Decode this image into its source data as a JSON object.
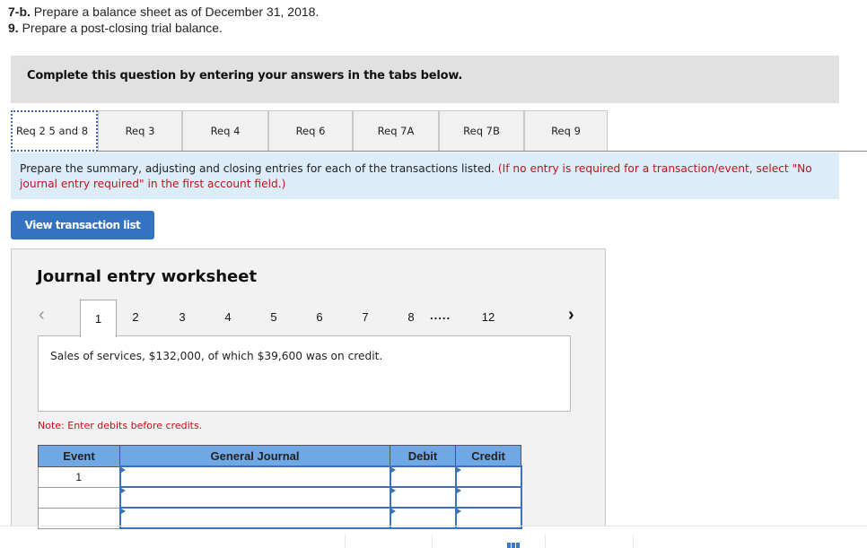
{
  "instructions": {
    "line1": {
      "prefix": "7-b.",
      "text": " Prepare a balance sheet as of December 31, 2018."
    },
    "line2": {
      "prefix": "9.",
      "text": " Prepare a post-closing trial balance."
    }
  },
  "banner": {
    "text": "Complete this question by entering your answers in the tabs below."
  },
  "tabs": [
    {
      "label": "Req 2 5 and 8",
      "active": true
    },
    {
      "label": "Req 3",
      "active": false
    },
    {
      "label": "Req 4",
      "active": false
    },
    {
      "label": "Req 6",
      "active": false
    },
    {
      "label": "Req 7A",
      "active": false
    },
    {
      "label": "Req 7B",
      "active": false
    },
    {
      "label": "Req 9",
      "active": false
    }
  ],
  "directions": {
    "main": "Prepare the summary, adjusting and closing entries for each of the transactions listed. ",
    "red": "(If no entry is required for a transaction/event, select \"No journal entry required\" in the first account field.)"
  },
  "view_button": {
    "label": "View transaction list"
  },
  "worksheet": {
    "title": "Journal entry worksheet",
    "pager": {
      "prev_icon": "chevron-left",
      "next_icon": "chevron-right",
      "pages": [
        "1",
        "2",
        "3",
        "4",
        "5",
        "6",
        "7",
        "8"
      ],
      "ellipsis": ".....",
      "last_page": "12",
      "active_page": "1"
    },
    "transaction": "Sales of services, $132,000, of which $39,600 was on credit.",
    "note": "Note: Enter debits before credits.",
    "table": {
      "headers": [
        "Event",
        "General Journal",
        "Debit",
        "Credit"
      ],
      "rows": [
        {
          "event": "1",
          "account": "",
          "debit": "",
          "credit": ""
        },
        {
          "event": "",
          "account": "",
          "debit": "",
          "credit": ""
        },
        {
          "event": "",
          "account": "",
          "debit": "",
          "credit": ""
        }
      ]
    }
  }
}
